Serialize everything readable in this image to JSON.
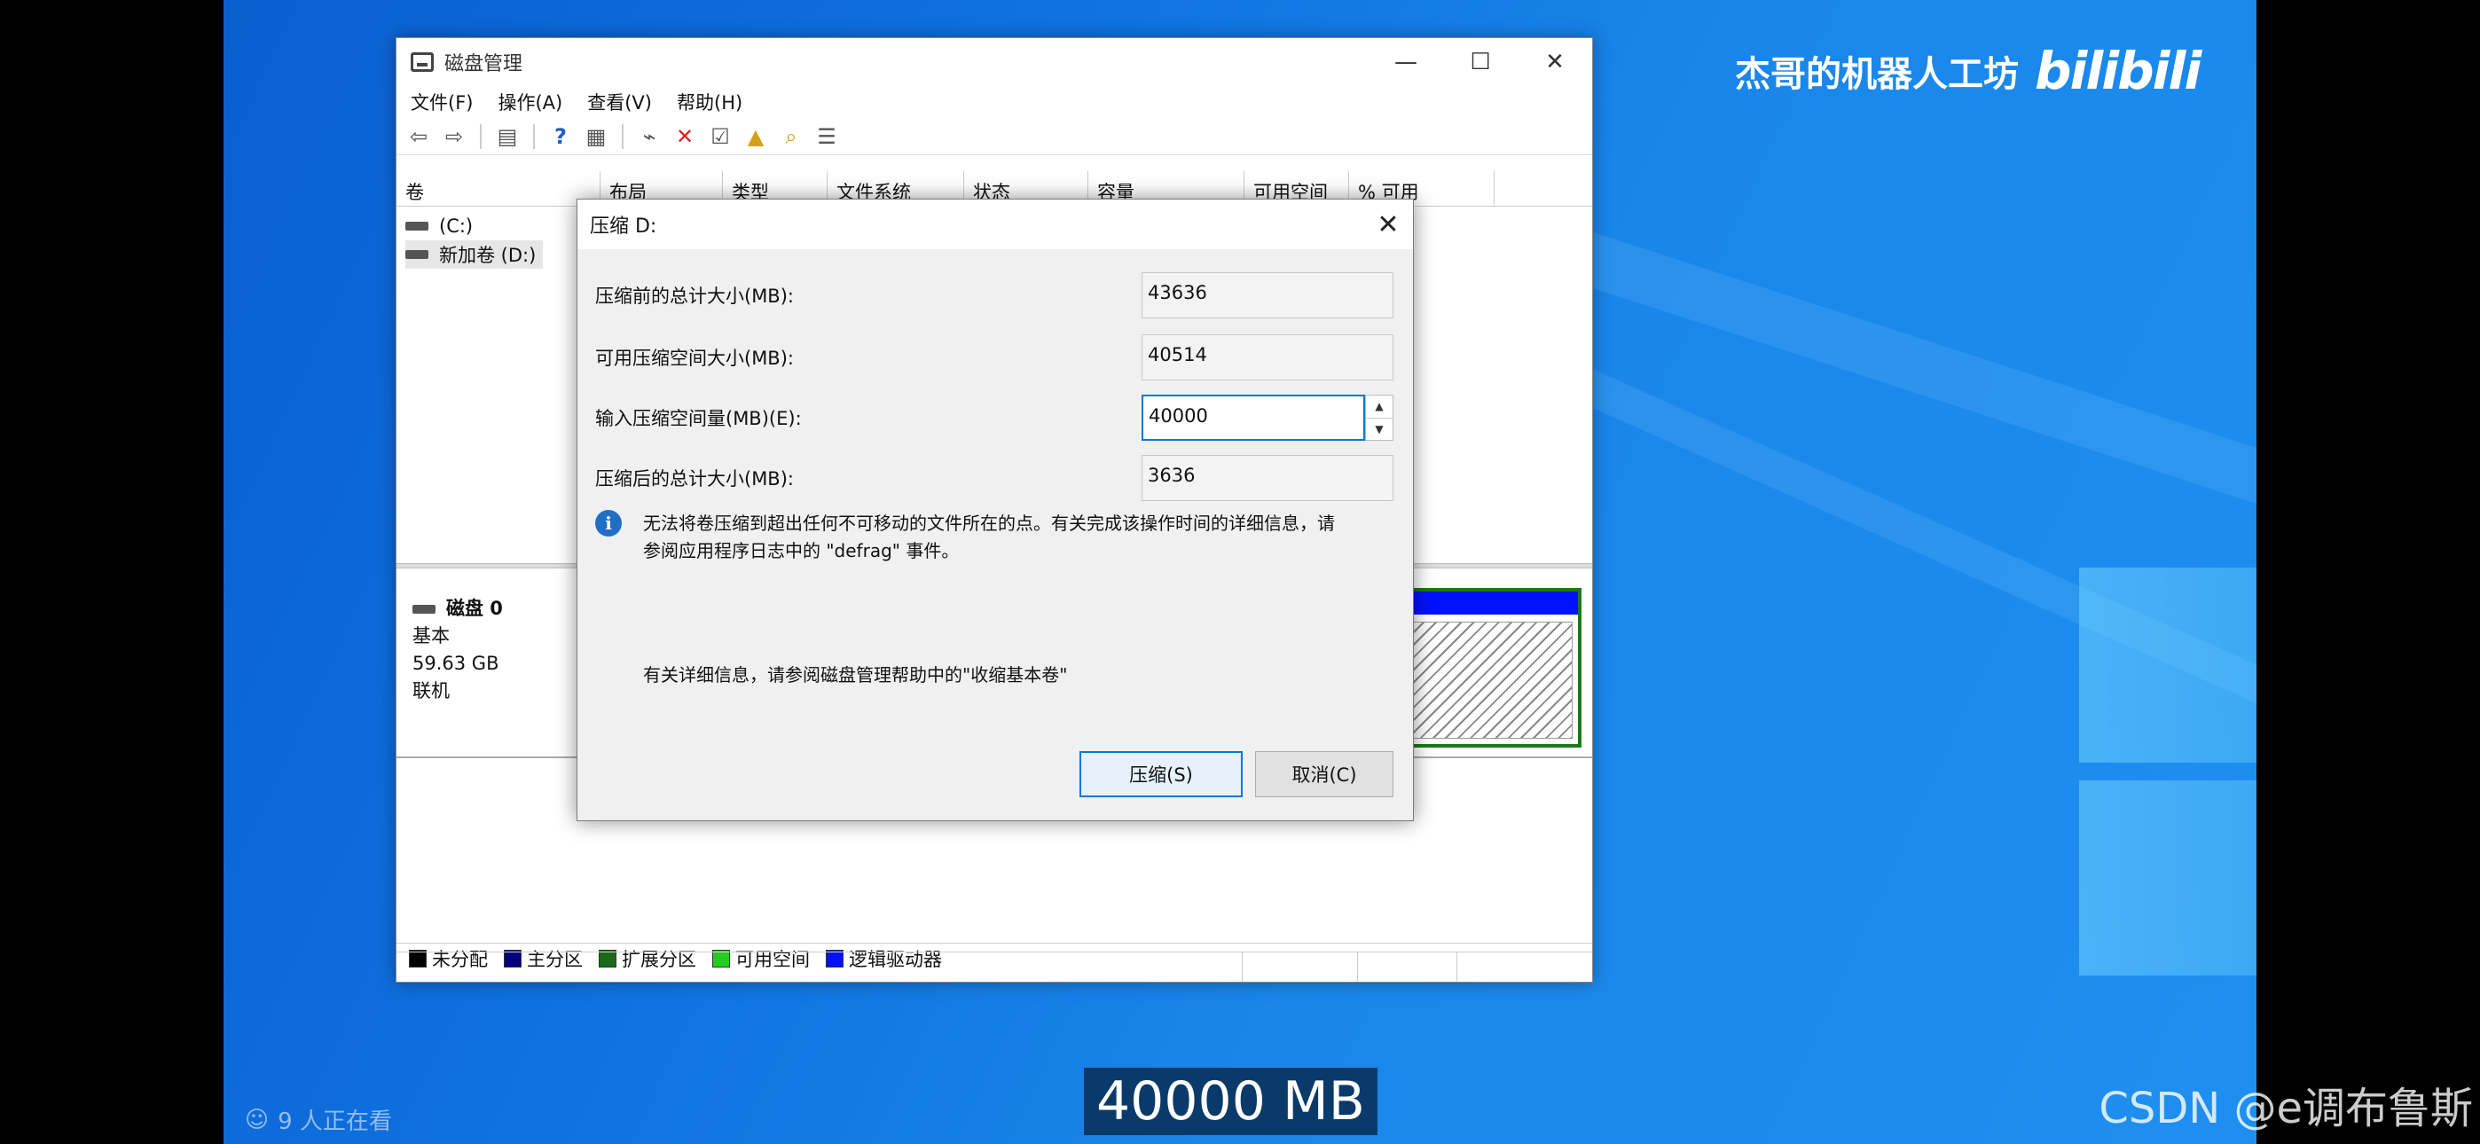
{
  "window": {
    "title": "磁盘管理",
    "controls": {
      "minimize": "—",
      "maximize": "☐",
      "close": "✕"
    }
  },
  "menu": [
    "文件(F)",
    "操作(A)",
    "查看(V)",
    "帮助(H)"
  ],
  "toolbar_icons": [
    "back-arrow-icon",
    "forward-arrow-icon",
    "console-tree-icon",
    "help-icon",
    "view-icon",
    "connect-icon",
    "delete-icon",
    "properties-icon",
    "folder-up-icon",
    "search-folder-icon",
    "list-icon"
  ],
  "columns": [
    "卷",
    "布局",
    "类型",
    "文件系统",
    "状态",
    "容量",
    "可用空间",
    "% 可用"
  ],
  "volumes": [
    "(C:)",
    "新加卷 (D:)"
  ],
  "disk": {
    "name": "磁盘 0",
    "type": "基本",
    "size": "59.63 GB",
    "status": "联机"
  },
  "legend": [
    "未分配",
    "主分区",
    "扩展分区",
    "可用空间",
    "逻辑驱动器"
  ],
  "legend_colors": [
    "#000000",
    "#000080",
    "#1a6a1a",
    "#22cc22",
    "#0011ff"
  ],
  "dialog": {
    "title": "压缩 D:",
    "close": "✕",
    "fields": {
      "total_before_label": "压缩前的总计大小(MB):",
      "total_before_value": "43636",
      "available_label": "可用压缩空间大小(MB):",
      "available_value": "40514",
      "input_label": "输入压缩空间量(MB)(E):",
      "input_value": "40000",
      "total_after_label": "压缩后的总计大小(MB):",
      "total_after_value": "3636"
    },
    "info_line1": "无法将卷压缩到超出任何不可移动的文件所在的点。有关完成该操作时间的详细信息，请",
    "info_line2": "参阅应用程序日志中的 \"defrag\" 事件。",
    "help": "有关详细信息，请参阅磁盘管理帮助中的\"收缩基本卷\"",
    "buttons": {
      "shrink": "压缩(S)",
      "cancel": "取消(C)"
    }
  },
  "overlay": {
    "watermark_text": "杰哥的机器人工坊",
    "watermark_logo": "bilibili",
    "viewers": "9 人正在看",
    "subtitle": "40000 MB",
    "csdn": "CSDN @e调布鲁斯"
  }
}
